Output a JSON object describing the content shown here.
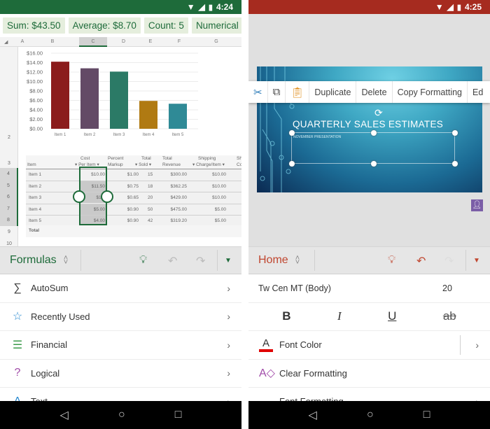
{
  "left": {
    "statusbar": {
      "time": "4:24",
      "wifi_icon": "wifi-icon",
      "signal_icon": "signal-icon",
      "battery_icon": "battery-icon"
    },
    "summary_chips": [
      "Sum: $43.50",
      "Average: $8.70",
      "Count: 5",
      "Numerical C"
    ],
    "column_headers": [
      "A",
      "B",
      "C",
      "D",
      "E",
      "F",
      "G"
    ],
    "row_headers": [
      "2",
      "3",
      "4",
      "5",
      "6",
      "7",
      "8",
      "9",
      "10"
    ],
    "table": {
      "headers": [
        {
          "line1": "",
          "line2": "Item"
        },
        {
          "line1": "Cost",
          "line2": "Per Item"
        },
        {
          "line1": "Percent",
          "line2": "Markup"
        },
        {
          "line1": "Total",
          "line2": "Sold"
        },
        {
          "line1": "Total",
          "line2": "Revenue"
        },
        {
          "line1": "Shipping",
          "line2": "Charge/Item"
        },
        {
          "line1": "Sh",
          "line2": "Co"
        }
      ],
      "rows": [
        {
          "item": "Item 1",
          "cost": "$10.00",
          "markup": "$1.00",
          "sold": "15",
          "revenue": "$300.00",
          "shipping": "$10.00"
        },
        {
          "item": "Item 2",
          "cost": "$11.50",
          "markup": "$0.75",
          "sold": "18",
          "revenue": "$362.25",
          "shipping": "$10.00"
        },
        {
          "item": "Item 3",
          "cost": "$13.",
          "markup": "$0.65",
          "sold": "20",
          "revenue": "$429.00",
          "shipping": "$10.00"
        },
        {
          "item": "Item 4",
          "cost": "$5.00",
          "markup": "$0.90",
          "sold": "50",
          "revenue": "$475.00",
          "shipping": "$5.00"
        },
        {
          "item": "Item 5",
          "cost": "$4.00",
          "markup": "$0.90",
          "sold": "42",
          "revenue": "$319.20",
          "shipping": "$5.00"
        }
      ],
      "total_label": "Total"
    },
    "ribbon": {
      "tab": "Formulas",
      "accent": "#1e6b3a"
    },
    "menu": [
      {
        "label": "AutoSum",
        "icon": "sigma-icon"
      },
      {
        "label": "Recently Used",
        "icon": "star-book-icon"
      },
      {
        "label": "Financial",
        "icon": "coins-book-icon"
      },
      {
        "label": "Logical",
        "icon": "question-book-icon"
      },
      {
        "label": "Text",
        "icon": "text-book-icon"
      }
    ]
  },
  "chart_data": {
    "type": "bar",
    "categories": [
      "Item 1",
      "Item 2",
      "Item 3",
      "Item 4",
      "Item 5"
    ],
    "values": [
      14.2,
      12.8,
      12.1,
      5.9,
      5.3
    ],
    "colors": [
      "#8b1c1c",
      "#634a66",
      "#2b7a66",
      "#b07a12",
      "#2f8a96"
    ],
    "title": "",
    "xlabel": "",
    "ylabel": "",
    "ylim": [
      0,
      16
    ],
    "yticks": [
      "$0.00",
      "$2.00",
      "$4.00",
      "$6.00",
      "$8.00",
      "$10.00",
      "$12.00",
      "$14.00",
      "$16.00"
    ],
    "grid": true
  },
  "right": {
    "statusbar": {
      "time": "4:25"
    },
    "context_menu": [
      "Duplicate",
      "Delete",
      "Copy Formatting",
      "Ed"
    ],
    "slide": {
      "title": "QUARTERLY SALES ESTIMATES",
      "subtitle": "NOVEMBER PRESENTATION"
    },
    "ribbon": {
      "tab": "Home",
      "accent": "#c0462f"
    },
    "font_name": "Tw Cen MT (Body)",
    "font_size": "20",
    "format_buttons": [
      "B",
      "I",
      "U",
      "ab"
    ],
    "menu": [
      {
        "label": "Font Color",
        "icon": "font-color-icon",
        "underline_color": "#e00000"
      },
      {
        "label": "Clear Formatting",
        "icon": "clear-formatting-icon"
      },
      {
        "label": "Font Formatting",
        "icon": ""
      }
    ]
  }
}
